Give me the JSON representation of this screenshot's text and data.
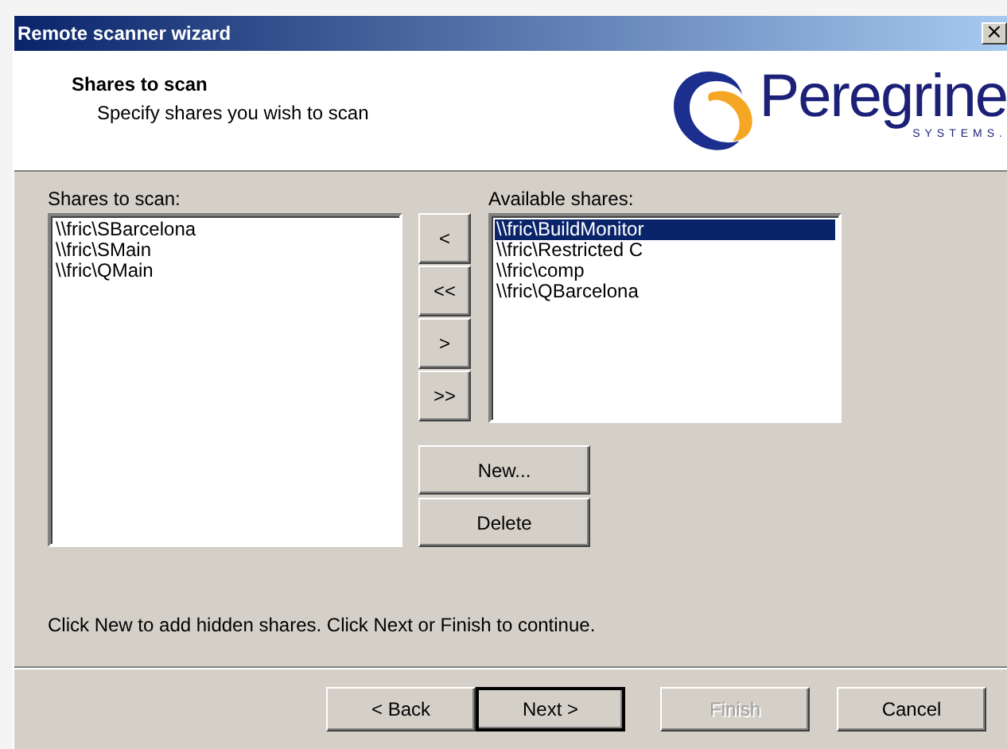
{
  "window": {
    "title": "Remote scanner wizard",
    "close": "×"
  },
  "header": {
    "title": "Shares to scan",
    "subtitle": "Specify shares you wish to scan",
    "logo": {
      "name": "Peregrine",
      "tagline": "SYSTEMS."
    }
  },
  "shares_to_scan": {
    "label": "Shares to scan:",
    "items": [
      {
        "text": "\\\\fric\\SBarcelona",
        "selected": false
      },
      {
        "text": "\\\\fric\\SMain",
        "selected": false
      },
      {
        "text": "\\\\fric\\QMain",
        "selected": false
      }
    ]
  },
  "move_buttons": [
    "<",
    "<<",
    ">",
    ">>"
  ],
  "available_shares": {
    "label": "Available shares:",
    "items": [
      {
        "text": "\\\\fric\\BuildMonitor",
        "selected": true
      },
      {
        "text": "\\\\fric\\Restricted C",
        "selected": false
      },
      {
        "text": "\\\\fric\\comp",
        "selected": false
      },
      {
        "text": "\\\\fric\\QBarcelona",
        "selected": false
      }
    ]
  },
  "share_buttons": [
    "New...",
    "Delete"
  ],
  "hint": "Click New to add hidden shares. Click Next or Finish to continue.",
  "nav_buttons": [
    {
      "label": "< Back",
      "disabled": false,
      "default": false
    },
    {
      "label": "Next >",
      "disabled": false,
      "default": true
    },
    {
      "label": "Finish",
      "disabled": true,
      "default": false
    },
    {
      "label": "Cancel",
      "disabled": false,
      "default": false
    }
  ]
}
